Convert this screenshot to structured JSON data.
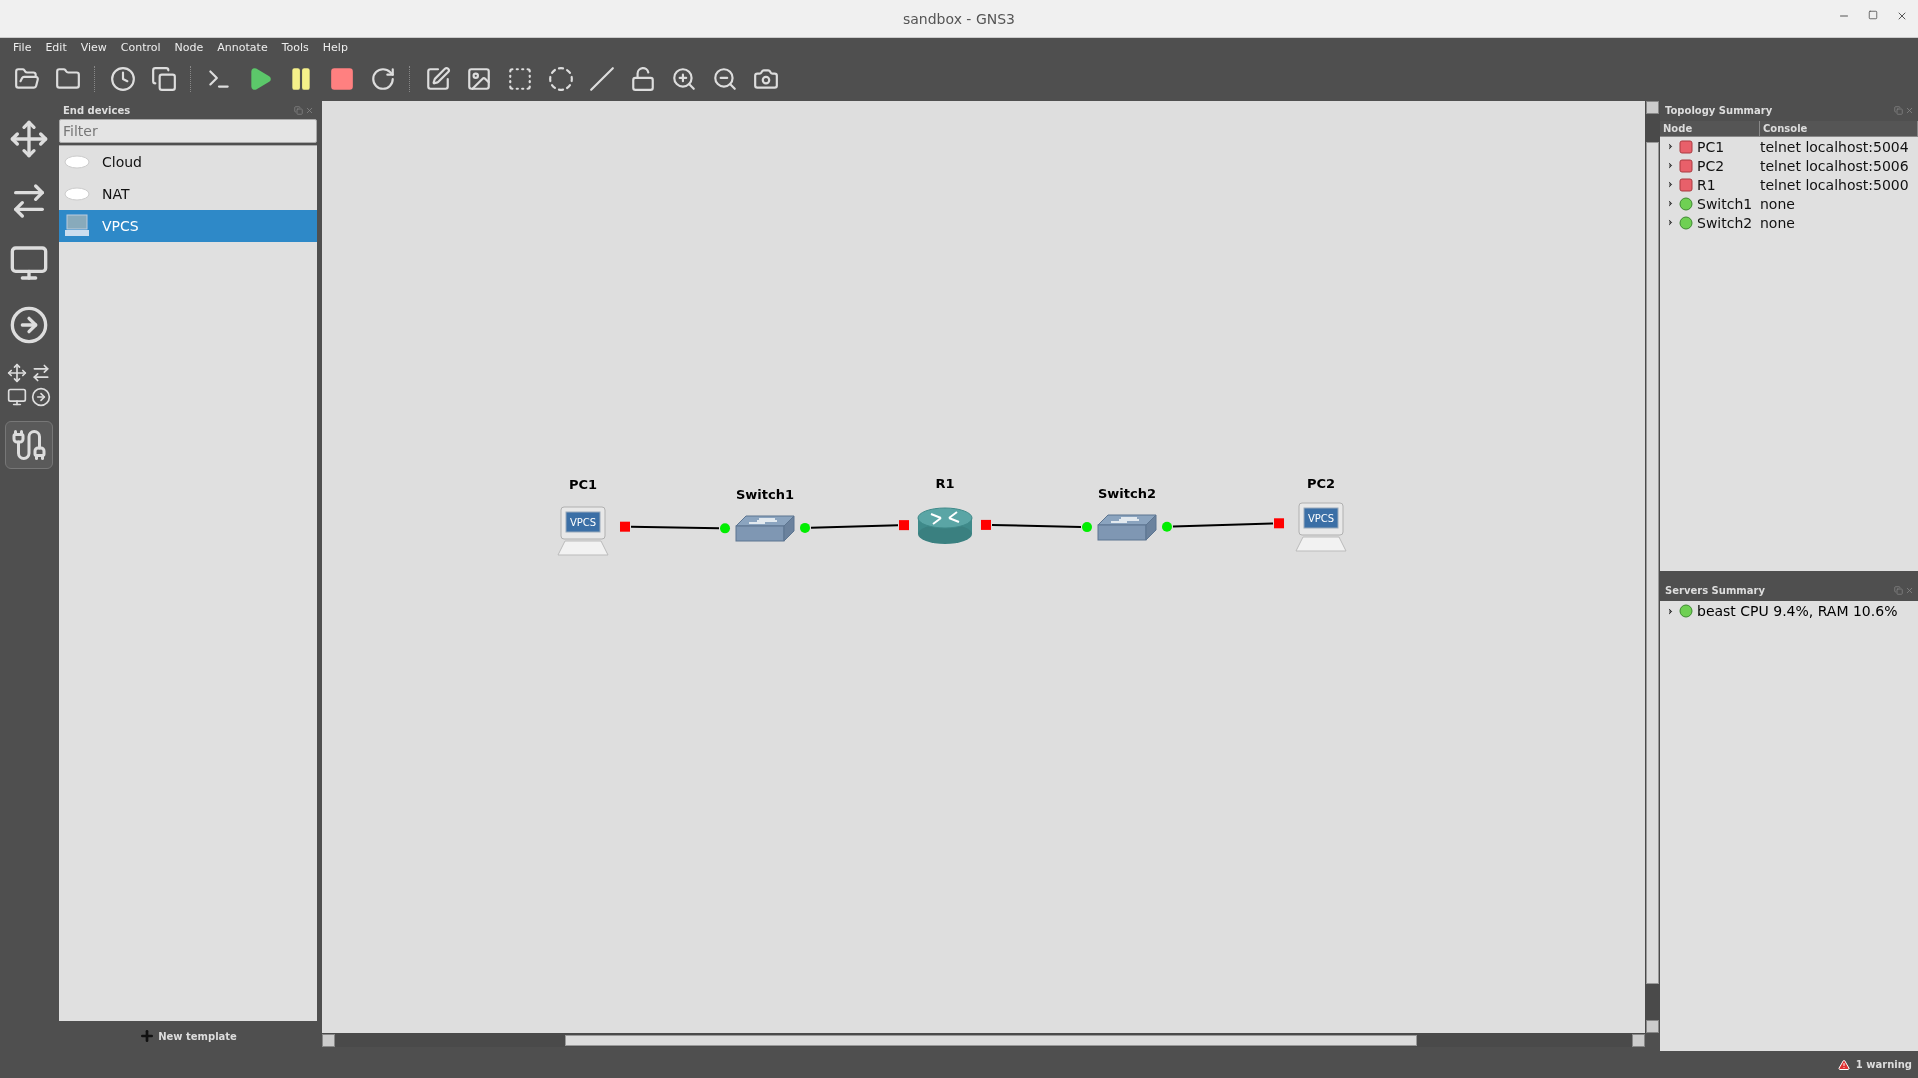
{
  "window": {
    "title": "sandbox - GNS3"
  },
  "menu": [
    "File",
    "Edit",
    "View",
    "Control",
    "Node",
    "Annotate",
    "Tools",
    "Help"
  ],
  "device_panel": {
    "title": "End devices",
    "filter": {
      "placeholder": "Filter"
    },
    "items": [
      {
        "label": "Cloud",
        "kind": "cloud",
        "selected": false
      },
      {
        "label": "NAT",
        "kind": "cloud",
        "selected": false
      },
      {
        "label": "VPCS",
        "kind": "vpcs",
        "selected": true
      }
    ],
    "new_template": "New template"
  },
  "canvas": {
    "nodes": [
      {
        "label": "PC1",
        "kind": "vpcs",
        "badge": "VPCS",
        "running": false
      },
      {
        "label": "Switch1",
        "kind": "switch",
        "running": true
      },
      {
        "label": "R1",
        "kind": "router",
        "running": false
      },
      {
        "label": "Switch2",
        "kind": "switch",
        "running": true
      },
      {
        "label": "PC2",
        "kind": "vpcs",
        "badge": "VPCS",
        "running": false
      }
    ]
  },
  "topology_summary": {
    "title": "Topology Summary",
    "columns": [
      "Node",
      "Console"
    ],
    "rows": [
      {
        "node": "PC1",
        "console": "telnet localhost:5004",
        "running": false
      },
      {
        "node": "PC2",
        "console": "telnet localhost:5006",
        "running": false
      },
      {
        "node": "R1",
        "console": "telnet localhost:5000",
        "running": false
      },
      {
        "node": "Switch1",
        "console": "none",
        "running": true
      },
      {
        "node": "Switch2",
        "console": "none",
        "running": true
      }
    ]
  },
  "servers_summary": {
    "title": "Servers Summary",
    "rows": [
      {
        "text": "beast CPU 9.4%, RAM 10.6%",
        "running": true
      }
    ]
  },
  "status_bar": {
    "warning": "1 warning"
  }
}
